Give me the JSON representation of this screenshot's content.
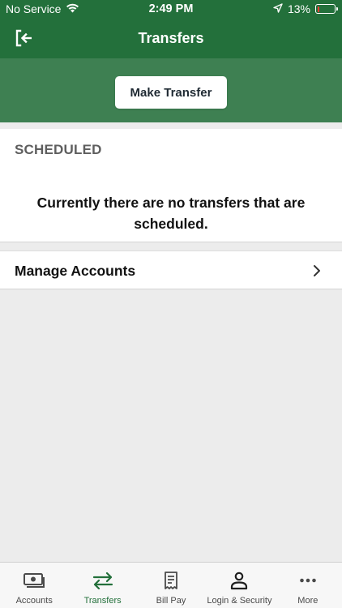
{
  "status_bar": {
    "carrier": "No Service",
    "time": "2:49 PM",
    "battery_text": "13%",
    "battery_level": 0.13,
    "battery_color": "#ff3b30"
  },
  "nav": {
    "title": "Transfers",
    "back_icon": "sign-out-icon"
  },
  "action": {
    "make_transfer_label": "Make Transfer"
  },
  "scheduled": {
    "heading": "SCHEDULED",
    "empty_message": "Currently there are no transfers that are scheduled."
  },
  "manage": {
    "label": "Manage Accounts",
    "icon": "chevron-right-icon"
  },
  "tabs": [
    {
      "label": "Accounts",
      "icon": "accounts-icon",
      "active": false
    },
    {
      "label": "Transfers",
      "icon": "transfers-icon",
      "active": true
    },
    {
      "label": "Bill Pay",
      "icon": "bill-pay-icon",
      "active": false
    },
    {
      "label": "Login & Security",
      "icon": "login-security-icon",
      "active": false
    },
    {
      "label": "More",
      "icon": "more-icon",
      "active": false
    }
  ],
  "colors": {
    "brand_green": "#23703b",
    "band_green": "#3e8052",
    "background": "#ececec"
  }
}
